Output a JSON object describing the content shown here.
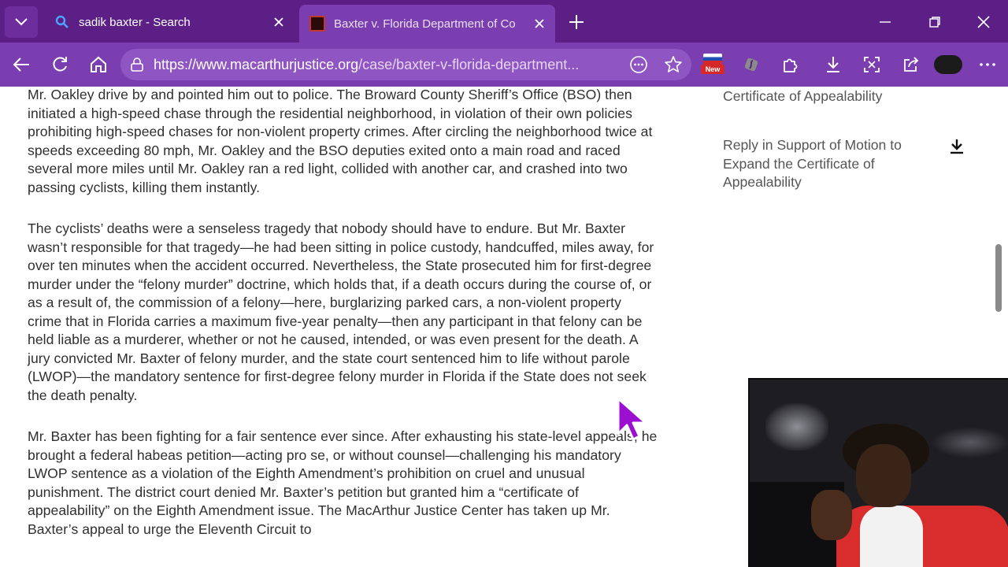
{
  "browser": {
    "tabs": [
      {
        "title": "sadik baxter - Search",
        "icon": "search-icon",
        "active": false
      },
      {
        "title": "Baxter v. Florida Department of Co",
        "icon": "macarthur-favicon",
        "active": true
      }
    ],
    "address": {
      "url_host": "https://www.macarthurjustice.org",
      "url_path": "/case/baxter-v-florida-department..."
    },
    "extension_badge": "New",
    "colors": {
      "tabbar": "#5b1f86",
      "toolbar": "#7b3eb0",
      "address": "#8f55c2"
    }
  },
  "article": {
    "paragraphs": [
      "Mr. Oakley drive by and pointed him out to police.  The Broward County Sheriff’s Office (BSO) then initiated a high-speed chase through the residential neighborhood, in violation of their own policies prohibiting high-speed chases for non-violent property crimes.   After circling the neighborhood twice at speeds exceeding 80 mph, Mr. Oakley and the BSO deputies exited onto a main road and raced several more miles until Mr. Oakley ran a red light, collided with another car, and crashed into two passing cyclists, killing them instantly.",
      "The cyclists’ deaths were a senseless tragedy that nobody should have to endure.  But Mr. Baxter wasn’t responsible for that tragedy—he had been sitting in police custody, handcuffed, miles away, for over ten minutes when the accident occurred.  Nevertheless, the State prosecuted him for first-degree murder under the “felony murder” doctrine, which holds that, if a death occurs during the course of, or as a result of, the commission of a felony—here, burglarizing parked cars, a non-violent property crime that in Florida carries a maximum five-year penalty—then any participant in that felony can be held liable as a murderer, whether or not he caused, intended, or was even present for the death.  A jury convicted Mr. Baxter of felony murder, and the state court sentenced him to life without parole (LWOP)—the mandatory sentence for first-degree felony murder in Florida if the State does not seek the death penalty.",
      "Mr. Baxter has been fighting for a fair sentence ever since.  After exhausting his state-level appeals, he brought a federal habeas petition—acting pro se, or without counsel—challenging his mandatory LWOP sentence as a violation of the Eighth Amendment’s prohibition on cruel and unusual punishment.  The district court denied Mr. Baxter’s petition but granted him a “certificate of appealability” on the Eighth Amendment issue.  The MacArthur Justice Center has taken up Mr. Baxter’s appeal to urge the Eleventh Circuit to"
    ]
  },
  "sidebar": {
    "documents": [
      {
        "title": "Certificate of Appealability",
        "download": false
      },
      {
        "title": "Reply in Support of Motion to Expand the Certificate of Appealability",
        "download": true
      }
    ]
  }
}
